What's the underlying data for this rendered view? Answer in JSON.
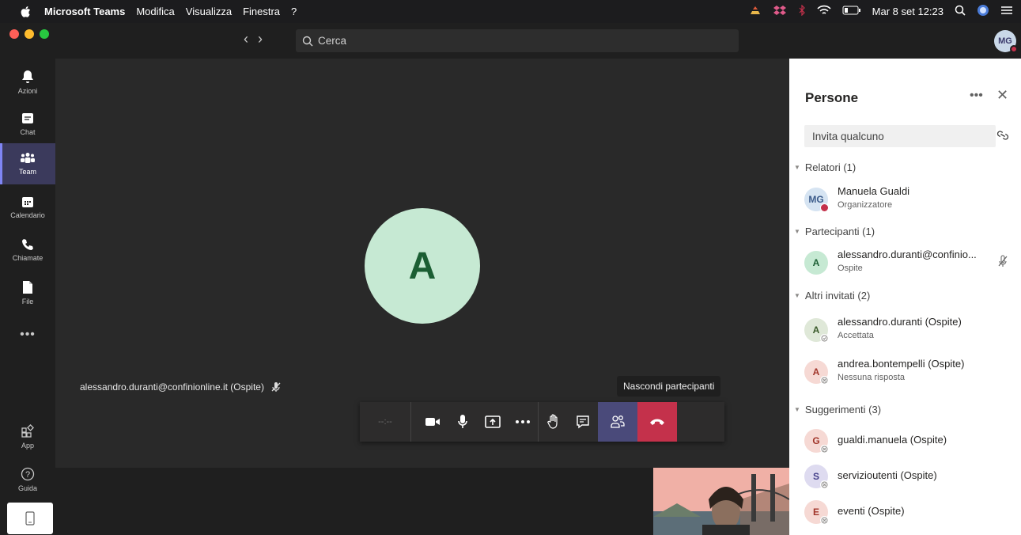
{
  "menubar": {
    "app_name": "Microsoft Teams",
    "items": [
      "Modifica",
      "Visualizza",
      "Finestra",
      "?"
    ],
    "clock": "Mar 8 set  12:23"
  },
  "header": {
    "search_placeholder": "Cerca",
    "user_initials": "MG"
  },
  "rail": {
    "items": [
      {
        "label": "Azioni",
        "icon": "bell-icon"
      },
      {
        "label": "Chat",
        "icon": "chat-icon"
      },
      {
        "label": "Team",
        "icon": "teams-icon"
      },
      {
        "label": "Calendario",
        "icon": "calendar-icon"
      },
      {
        "label": "Chiamate",
        "icon": "phone-icon"
      },
      {
        "label": "File",
        "icon": "file-icon"
      }
    ],
    "more": "•••",
    "apps_label": "App",
    "help_label": "Guida"
  },
  "stage": {
    "avatar_letter": "A",
    "participant_name": "alessandro.duranti@confinionline.it (Ospite)"
  },
  "callbar": {
    "timer": "--:--",
    "tooltip": "Nascondi partecipanti"
  },
  "people": {
    "title": "Persone",
    "invite_placeholder": "Invita qualcuno",
    "sections": {
      "relatori": "Relatori (1)",
      "partecipanti": "Partecipanti (1)",
      "altri": "Altri invitati (2)",
      "suggerimenti": "Suggerimenti (3)"
    },
    "relatori": [
      {
        "initials": "MG",
        "name": "Manuela Gualdi",
        "sub": "Organizzatore"
      }
    ],
    "partecipanti": [
      {
        "initials": "A",
        "name": "alessandro.duranti@confinio...",
        "sub": "Ospite"
      }
    ],
    "altri": [
      {
        "initials": "A",
        "name": "alessandro.duranti (Ospite)",
        "sub": "Accettata"
      },
      {
        "initials": "A",
        "name": "andrea.bontempelli (Ospite)",
        "sub": "Nessuna risposta"
      }
    ],
    "suggerimenti": [
      {
        "initials": "G",
        "name": "gualdi.manuela (Ospite)"
      },
      {
        "initials": "S",
        "name": "servizioutenti (Ospite)"
      },
      {
        "initials": "E",
        "name": "eventi (Ospite)"
      }
    ]
  },
  "colors": {
    "accent": "#7f85f5",
    "hangup": "#c4314b",
    "stage": "#292929",
    "panel": "#ffffff"
  }
}
